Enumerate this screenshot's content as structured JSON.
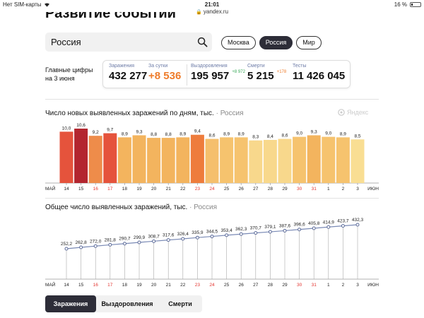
{
  "status_bar": {
    "carrier": "Нет SIM-карты",
    "time": "21:01",
    "battery": "16 %",
    "battery_level": 0.16,
    "url": "yandex.ru"
  },
  "page_title": "Развитие событий",
  "search": {
    "value": "Россия"
  },
  "region_tabs": [
    "Москва",
    "Россия",
    "Мир"
  ],
  "region_active": "Россия",
  "key_figures": {
    "label_line1": "Главные цифры",
    "label_line2": "на 3 июня",
    "infected_label": "Заражения",
    "infected_value": "432 277",
    "daily_label": "За сутки",
    "daily_value": "+8 536",
    "recovered_label": "Выздоровления",
    "recovered_value": "195 957",
    "recovered_delta": "+8 972",
    "deaths_label": "Смерти",
    "deaths_value": "5 215",
    "deaths_delta": "+178",
    "tests_label": "Тесты",
    "tests_value": "11 426 045"
  },
  "brand": "Яндекс",
  "colors": {
    "accent_orange": "#ee7c2b",
    "delta_green": "#3aaa5a",
    "delta_orange": "#ee7c2b",
    "weekend_red": "#e3342f",
    "dark": "#2d2d38"
  },
  "chart_data": [
    {
      "type": "bar",
      "title": "Число новых выявленных заражений по дням, тыс.",
      "subtitle": "Россия",
      "start_label": "МАЙ",
      "end_label": "ИЮН",
      "categories": [
        "14",
        "15",
        "16",
        "17",
        "18",
        "19",
        "20",
        "21",
        "22",
        "23",
        "24",
        "25",
        "26",
        "27",
        "28",
        "29",
        "30",
        "31",
        "1",
        "2",
        "3"
      ],
      "weekend": [
        false,
        false,
        true,
        true,
        false,
        false,
        false,
        false,
        false,
        true,
        true,
        false,
        false,
        false,
        false,
        false,
        true,
        true,
        false,
        false,
        false
      ],
      "values": [
        10.0,
        10.6,
        9.2,
        9.7,
        8.9,
        9.3,
        8.8,
        8.8,
        8.9,
        9.4,
        8.6,
        8.9,
        8.9,
        8.3,
        8.4,
        8.6,
        9.0,
        9.3,
        9.0,
        8.9,
        8.5
      ],
      "value_labels": [
        "10,0",
        "10,6",
        "9,2",
        "9,7",
        "8,9",
        "9,3",
        "8,8",
        "8,8",
        "8,9",
        "9,4",
        "8,6",
        "8,9",
        "8,9",
        "8,3",
        "8,4",
        "8,6",
        "9,0",
        "9,3",
        "9,0",
        "8,9",
        "8,5"
      ],
      "bar_colors": [
        "#e5533c",
        "#b3262f",
        "#ee8c4a",
        "#e5533c",
        "#f3b45e",
        "#f3b45e",
        "#f3b45e",
        "#f3b45e",
        "#f3b45e",
        "#ee7c3c",
        "#f5bf6c",
        "#f6c36e",
        "#f6c36e",
        "#f8d88c",
        "#f8d88c",
        "#f8d88c",
        "#f6c36e",
        "#f3b45e",
        "#f6c36e",
        "#f6c36e",
        "#f9de93"
      ],
      "ylim": [
        0,
        10.6
      ]
    },
    {
      "type": "line",
      "title": "Общее число выявленных заражений, тыс.",
      "subtitle": "Россия",
      "start_label": "МАЙ",
      "end_label": "ИЮН",
      "categories": [
        "14",
        "15",
        "16",
        "17",
        "18",
        "19",
        "20",
        "21",
        "22",
        "23",
        "24",
        "25",
        "26",
        "27",
        "28",
        "29",
        "30",
        "31",
        "1",
        "2",
        "3"
      ],
      "weekend": [
        false,
        false,
        true,
        true,
        false,
        false,
        false,
        false,
        false,
        true,
        true,
        false,
        false,
        false,
        false,
        false,
        true,
        true,
        false,
        false,
        false
      ],
      "values": [
        252.2,
        262.8,
        272.0,
        281.8,
        290.7,
        299.9,
        308.7,
        317.6,
        326.4,
        335.9,
        344.5,
        353.4,
        362.3,
        370.7,
        379.1,
        387.6,
        396.6,
        405.8,
        414.9,
        423.7,
        432.3
      ],
      "value_labels": [
        "252,2",
        "262,8",
        "272,0",
        "281,8",
        "290,7",
        "299,9",
        "308,7",
        "317,6",
        "326,4",
        "335,9",
        "344,5",
        "353,4",
        "362,3",
        "370,7",
        "379,1",
        "387,6",
        "396,6",
        "405,8",
        "414,9",
        "423,7",
        "432,3"
      ],
      "ylim": [
        0,
        432.3
      ]
    }
  ],
  "bottom_tabs": [
    "Заражения",
    "Выздоровления",
    "Смерти"
  ],
  "bottom_active": "Заражения"
}
